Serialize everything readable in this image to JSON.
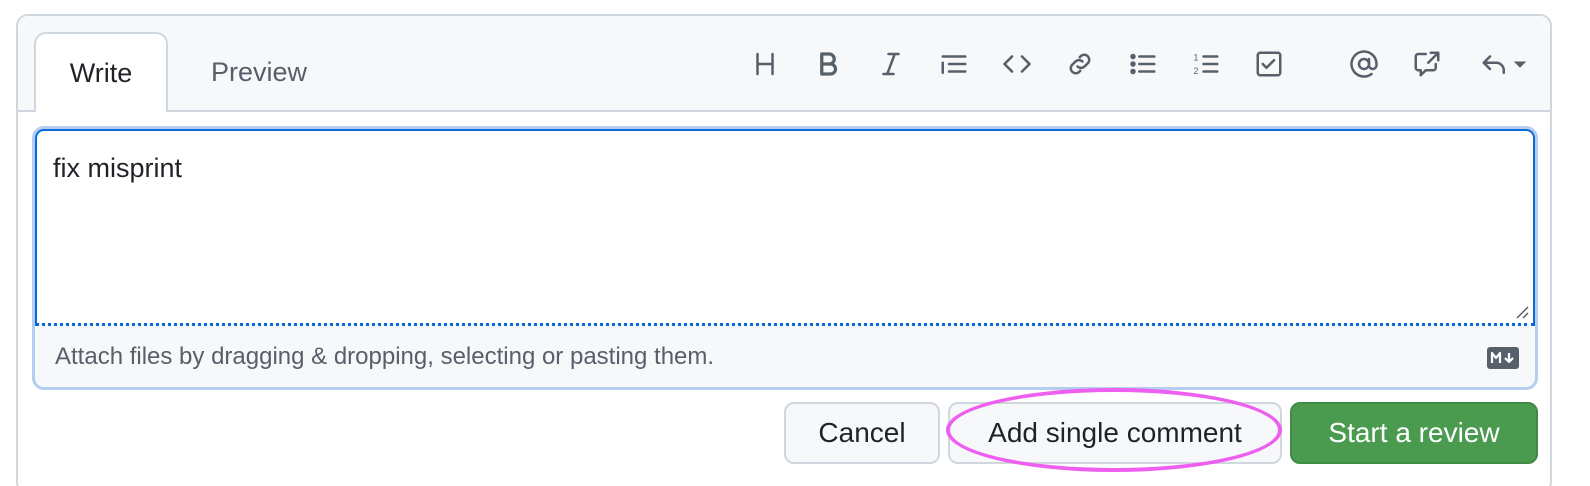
{
  "tabs": {
    "write": "Write",
    "preview": "Preview"
  },
  "toolbar": {
    "icons": [
      "heading-icon",
      "bold-icon",
      "italic-icon",
      "quote-icon",
      "code-icon",
      "link-icon",
      "bulleted-list-icon",
      "numbered-list-icon",
      "task-list-icon",
      "mention-icon",
      "reference-icon",
      "saved-replies-icon"
    ]
  },
  "editor": {
    "value": "fix misprint",
    "attach_hint": "Attach files by dragging & dropping, selecting or pasting them."
  },
  "actions": {
    "cancel": "Cancel",
    "add_single": "Add single comment",
    "start_review": "Start a review"
  },
  "colors": {
    "accent": "#0969da",
    "primary_button": "#4a9a50",
    "highlight": "#ee5ff0"
  }
}
